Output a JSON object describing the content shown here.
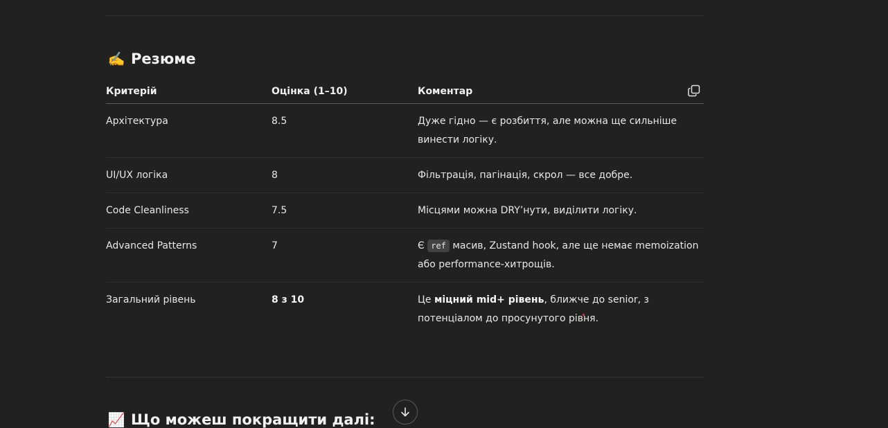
{
  "summary": {
    "emoji": "✍️",
    "title": "Резюме"
  },
  "table": {
    "headers": {
      "criterion": "Критерій",
      "score": "Оцінка (1–10)",
      "comment": "Коментар"
    },
    "rows": [
      {
        "criterion": "Архітектура",
        "score": "8.5",
        "comment_line1": "Дуже гідно — є розбиття, але можна ще сильніше",
        "comment_line2": "винести логіку."
      },
      {
        "criterion": "UI/UX логіка",
        "score": "8",
        "comment_line1": "Фільтрація, пагінація, скрол — все добре."
      },
      {
        "criterion": "Code Cleanliness",
        "score": "7.5",
        "comment_line1": "Місцями можна DRY’нути, виділити логіку."
      },
      {
        "criterion": "Advanced Patterns",
        "score": "7",
        "comment_prefix": "Є",
        "comment_code": "ref",
        "comment_suffix": "масив, Zustand hook, але ще немає memoization",
        "comment_line2": "або performance-хитрощів."
      },
      {
        "criterion": "Загальний рівень",
        "score": "8 з 10",
        "comment_prefix": "Це",
        "comment_bold": "міцний mid+ рівень",
        "comment_suffix": ", ближче до senior, з",
        "comment_line2": "потенціалом до просунутого рівня."
      }
    ]
  },
  "next_section": {
    "emoji": "📈",
    "title": "Що можеш покращити далі:"
  },
  "icons": {
    "copy": "copy-icon",
    "scroll_down": "arrow-down-icon"
  }
}
